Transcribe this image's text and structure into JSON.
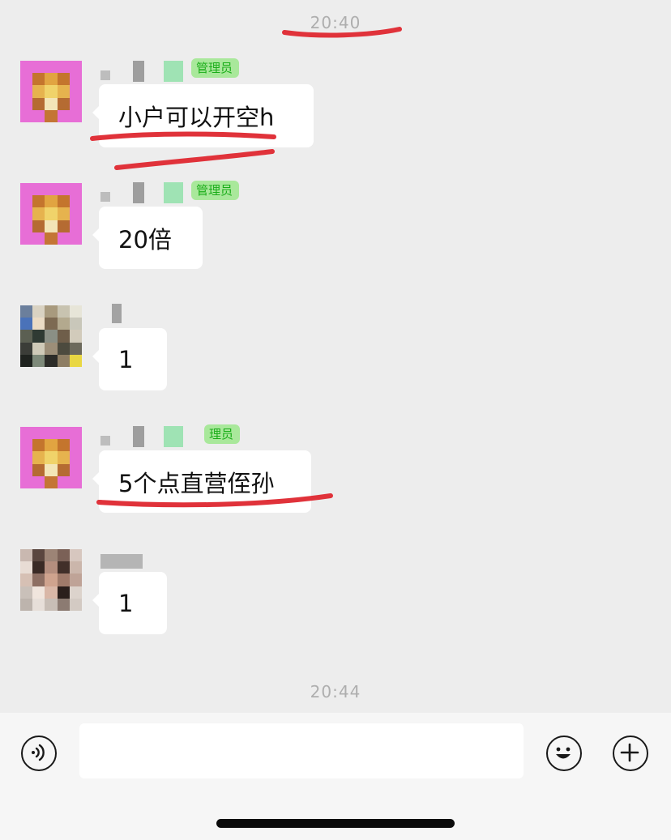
{
  "chat": {
    "timestamps": [
      "20:40",
      "20:44"
    ],
    "admin_badge": "管理员",
    "admin_badge_partial": "理员",
    "messages": [
      {
        "sender": "admin",
        "text": "小户可以开空h"
      },
      {
        "sender": "admin",
        "text": "20倍"
      },
      {
        "sender": "member-1",
        "text": "1"
      },
      {
        "sender": "admin",
        "text": "5个点直营侄孙"
      },
      {
        "sender": "member-2",
        "text": "1"
      }
    ]
  },
  "input_bar": {
    "icons": [
      "voice-icon",
      "emoji-icon",
      "plus-icon"
    ],
    "text_value": ""
  },
  "colors": {
    "background": "#ededed",
    "bubble": "#ffffff",
    "badge_bg": "#a9e89b",
    "badge_text": "#1aad19",
    "annotation_red": "#e0323a"
  }
}
